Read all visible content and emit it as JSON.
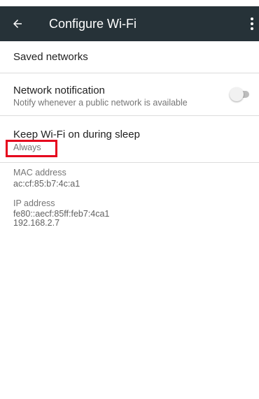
{
  "toolbar": {
    "title": "Configure Wi-Fi",
    "back_icon": "arrow-back-icon",
    "menu_icon": "more-vert-icon",
    "background": "#263238"
  },
  "preferences": {
    "saved_networks": {
      "title": "Saved networks"
    },
    "network_notification": {
      "title": "Network notification",
      "summary": "Notify whenever a public network is available",
      "switch_on": false
    },
    "keep_wifi_sleep": {
      "title": "Keep Wi-Fi on during sleep",
      "summary": "Always"
    }
  },
  "info": {
    "mac": {
      "label": "MAC address",
      "value": "ac:cf:85:b7:4c:a1"
    },
    "ip": {
      "label": "IP address",
      "value_line1": "fe80::aecf:85ff:feb7:4ca1",
      "value_line2": "192.168.2.7"
    }
  },
  "highlight_color": "#e5001c"
}
